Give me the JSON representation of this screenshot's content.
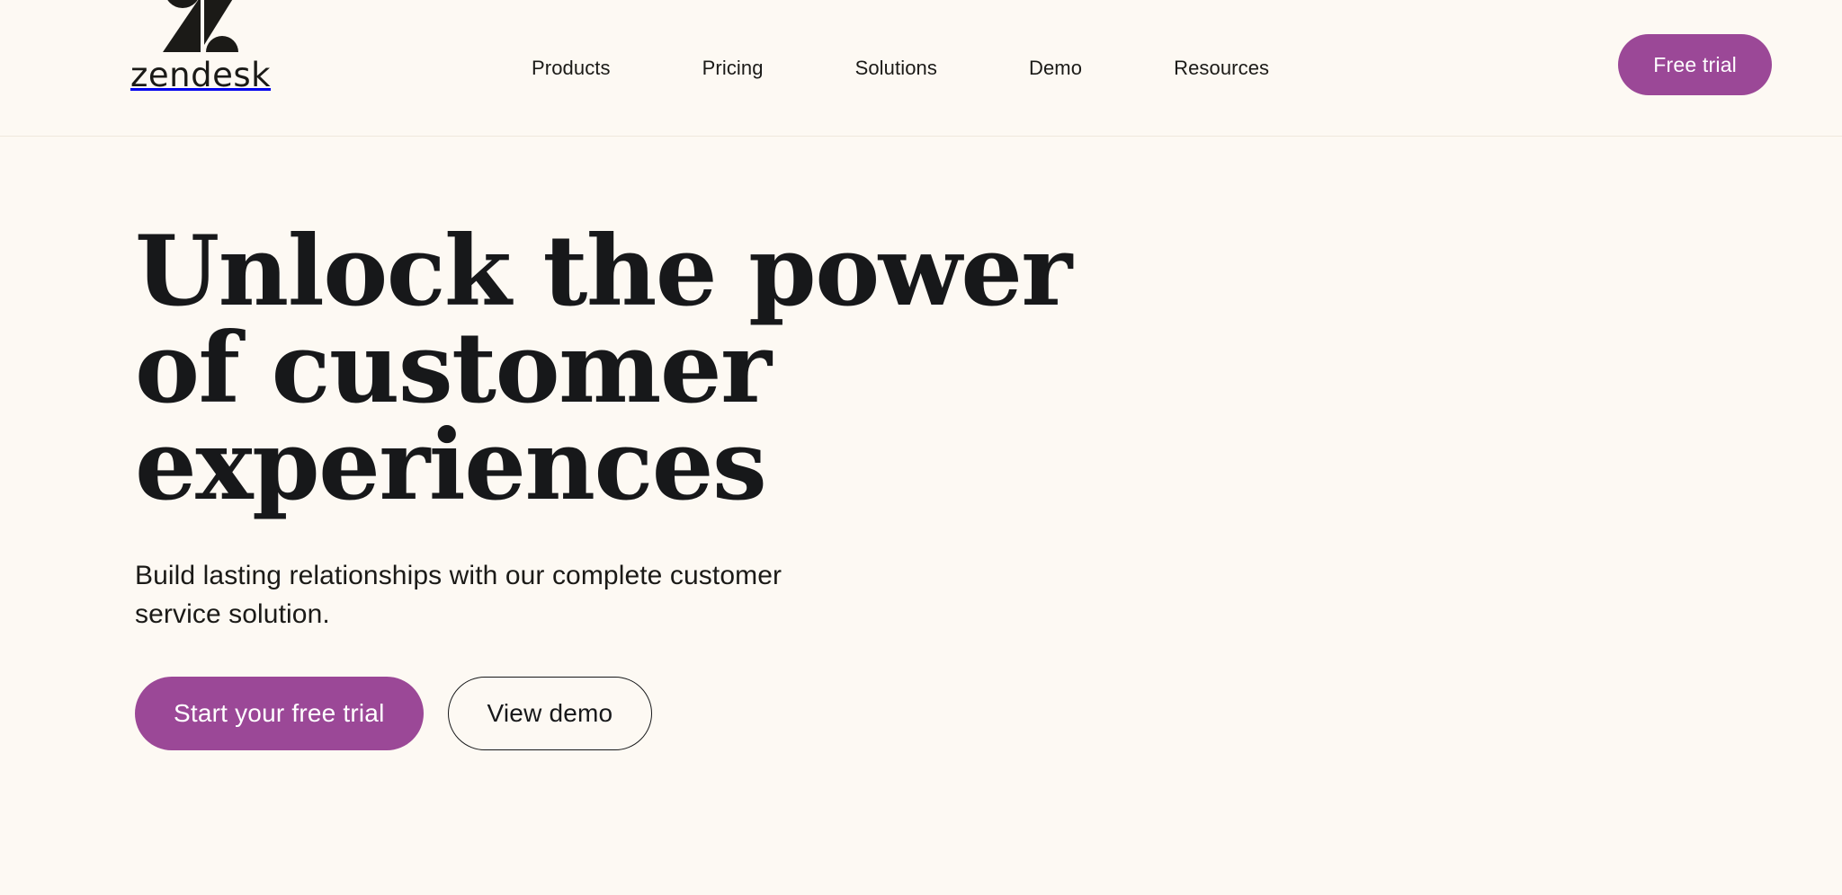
{
  "theme": {
    "background": "#FDF9F3",
    "text": "#17181A",
    "accent_purple": "#9B4897",
    "divider": "#EFE8DD",
    "button_text": "#FFFFFF"
  },
  "header": {
    "logo": {
      "mark_icon": "zendesk-z-logo-icon",
      "wordmark": "zendesk"
    },
    "nav_items": [
      {
        "label": "Products"
      },
      {
        "label": "Pricing"
      },
      {
        "label": "Solutions"
      },
      {
        "label": "Demo"
      },
      {
        "label": "Resources"
      }
    ],
    "cta": {
      "label": "Free trial"
    }
  },
  "hero": {
    "headline_lines": [
      "Unlock the power",
      "of customer",
      "experiences"
    ],
    "subhead_lines": [
      "Build lasting relationships with our complete customer",
      "service solution."
    ],
    "buttons": {
      "primary": "Start your free trial",
      "secondary": "View demo"
    }
  }
}
